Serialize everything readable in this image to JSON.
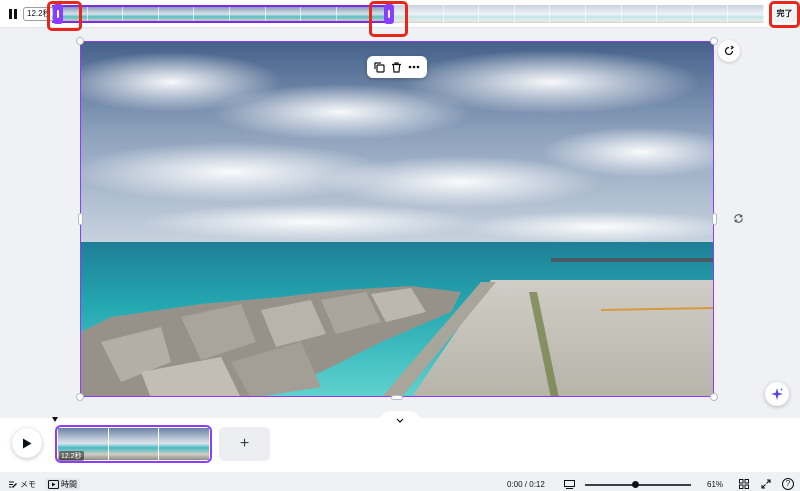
{
  "topbar": {
    "current_time": "12.2秒",
    "done_label": "完了",
    "trim_fraction": 0.48
  },
  "timeline": {
    "clip_duration": "12.2秒",
    "add_label": "+"
  },
  "footer": {
    "memo_label": "メモ",
    "time_label": "時間",
    "counter": "0:00 / 0:12",
    "zoom": "61%",
    "help": "?"
  },
  "colors": {
    "accent": "#8b3dff",
    "highlight": "#e8261a"
  },
  "icons": [
    "pause-icon",
    "copy-icon",
    "trash-icon",
    "more-icon",
    "refresh-icon",
    "rotate-icon",
    "magic-icon",
    "play-icon",
    "chevron-down-icon",
    "memo-icon",
    "time-icon",
    "slide-icon",
    "grid-icon",
    "expand-icon",
    "help-icon"
  ]
}
